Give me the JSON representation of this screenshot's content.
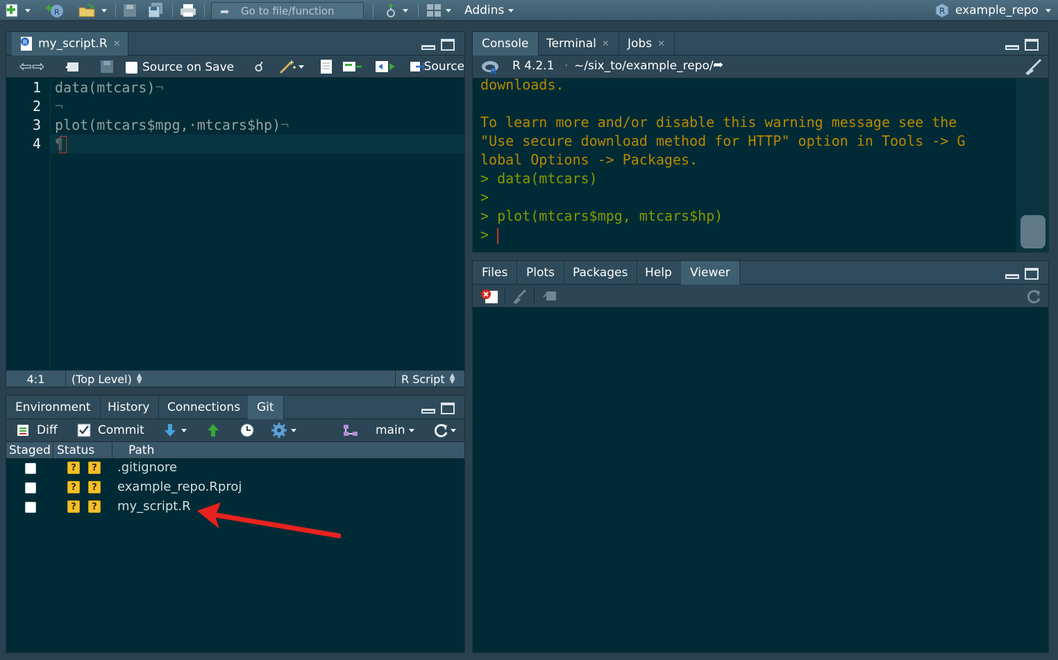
{
  "topbar": {
    "goto_placeholder": "Go to file/function",
    "addins_label": "Addins",
    "project_label": "example_repo"
  },
  "editor": {
    "tab_label": "my_script.R",
    "source_on_save_label": "Source on Save",
    "source_label": "Source",
    "line_numbers": [
      "1",
      "2",
      "3",
      "4"
    ],
    "code_lines": [
      "data(mtcars)",
      "",
      "plot(mtcars$mpg,·mtcars$hp)",
      ""
    ],
    "status": {
      "position": "4:1",
      "scope": "(Top Level)",
      "filetype": "R Script"
    }
  },
  "git_pane": {
    "tabs": [
      "Environment",
      "History",
      "Connections",
      "Git"
    ],
    "active_tab": "Git",
    "toolbar": {
      "diff_label": "Diff",
      "commit_label": "Commit",
      "branch_label": "main"
    },
    "columns": [
      "Staged",
      "Status",
      "Path"
    ],
    "rows": [
      {
        "path": ".gitignore",
        "status": "?"
      },
      {
        "path": "example_repo.Rproj",
        "status": "?"
      },
      {
        "path": "my_script.R",
        "status": "?"
      }
    ]
  },
  "console_pane": {
    "tabs": [
      "Console",
      "Terminal",
      "Jobs"
    ],
    "r_version": "R 4.2.1",
    "working_dir": "~/six_to/example_repo/",
    "lines": [
      "downloads.",
      "",
      "To learn more and/or disable this warning message see the",
      "\"Use secure download method for HTTP\" option in Tools -> G",
      "lobal Options -> Packages.",
      "> data(mtcars)",
      ">",
      "> plot(mtcars$mpg, mtcars$hp)",
      ">"
    ]
  },
  "viewer_pane": {
    "tabs": [
      "Files",
      "Plots",
      "Packages",
      "Help",
      "Viewer"
    ],
    "active_tab": "Viewer"
  },
  "colors": {
    "background": "#002b36",
    "annotation_arrow": "#e8221e",
    "console_text": "#b58900",
    "prompt": "#859900",
    "badge": "#f2c029"
  }
}
